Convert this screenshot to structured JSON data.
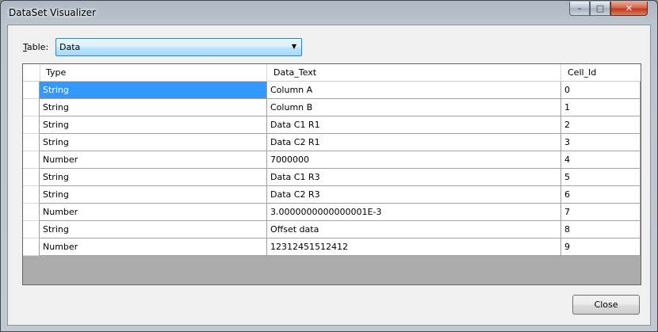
{
  "window": {
    "title": "DataSet Visualizer",
    "controls": {
      "minimize": "–",
      "maximize": "□",
      "close": "✕"
    }
  },
  "table_selector": {
    "label_accel": "T",
    "label_rest": "able:",
    "selected": "Data"
  },
  "grid": {
    "columns": [
      "Type",
      "Data_Text",
      "Cell_Id"
    ],
    "rows": [
      [
        "String",
        "Column A",
        "0"
      ],
      [
        "String",
        "Column B",
        "1"
      ],
      [
        "String",
        "Data C1 R1",
        "2"
      ],
      [
        "String",
        "Data C2 R1",
        "3"
      ],
      [
        "Number",
        "7000000",
        "4"
      ],
      [
        "String",
        "Data C1 R3",
        "5"
      ],
      [
        "String",
        "Data C2 R3",
        "6"
      ],
      [
        "Number",
        "3.0000000000000001E-3",
        "7"
      ],
      [
        "String",
        "Offset data",
        "8"
      ],
      [
        "Number",
        "12312451512412",
        "9"
      ]
    ]
  },
  "buttons": {
    "close": "Close"
  },
  "colors": {
    "selection": "#3399ff",
    "grid_empty": "#ababab"
  }
}
